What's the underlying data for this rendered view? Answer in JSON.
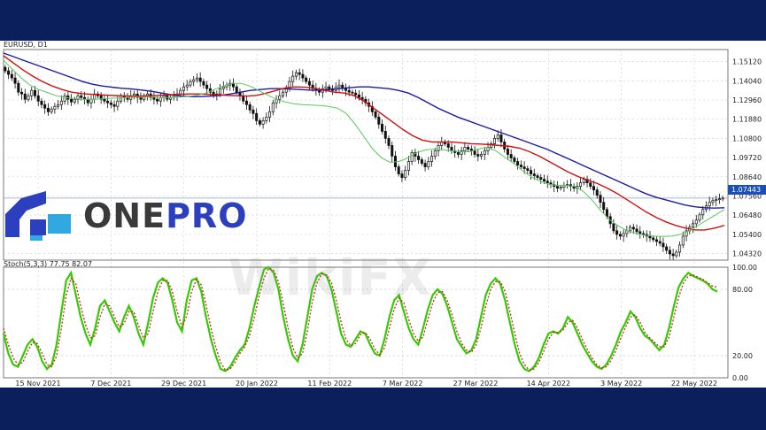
{
  "branding": {
    "logo_text_1": "ONE",
    "logo_text_2": "PRO",
    "watermark": "WikiFX",
    "colors": {
      "frame": "#0b1f5c",
      "logo_dark": "#3a3a3a",
      "logo_blue": "#2b3fbf",
      "logo_light": "#31a8e0"
    }
  },
  "chart_data": [
    {
      "type": "candlestick",
      "title": "EURUSD, D1",
      "current_price": 1.07443,
      "current_price_label": "1.07443",
      "ylim": [
        1.0395,
        1.158
      ],
      "y_ticks": [
        "1.15120",
        "1.14040",
        "1.12960",
        "1.11880",
        "1.10800",
        "1.09720",
        "1.08640",
        "1.07560",
        "1.06480",
        "1.05400",
        "1.04320"
      ],
      "x_ticks": [
        "15 Nov 2021",
        "7 Dec 2021",
        "29 Dec 2021",
        "20 Jan 2022",
        "11 Feb 2022",
        "7 Mar 2022",
        "27 Mar 2022",
        "14 Apr 2022",
        "3 May 2022",
        "22 May 2022"
      ],
      "close": [
        1.146,
        1.144,
        1.142,
        1.139,
        1.134,
        1.133,
        1.13,
        1.132,
        1.135,
        1.132,
        1.129,
        1.127,
        1.125,
        1.123,
        1.1245,
        1.126,
        1.127,
        1.129,
        1.132,
        1.13,
        1.1285,
        1.13,
        1.132,
        1.131,
        1.13,
        1.128,
        1.13,
        1.133,
        1.132,
        1.13,
        1.129,
        1.128,
        1.127,
        1.126,
        1.129,
        1.132,
        1.131,
        1.13,
        1.132,
        1.133,
        1.131,
        1.13,
        1.132,
        1.133,
        1.131,
        1.13,
        1.129,
        1.131,
        1.132,
        1.13,
        1.131,
        1.132,
        1.133,
        1.135,
        1.137,
        1.138,
        1.14,
        1.141,
        1.142,
        1.14,
        1.138,
        1.136,
        1.134,
        1.132,
        1.133,
        1.136,
        1.137,
        1.138,
        1.139,
        1.137,
        1.134,
        1.132,
        1.129,
        1.127,
        1.124,
        1.122,
        1.118,
        1.116,
        1.118,
        1.12,
        1.123,
        1.128,
        1.13,
        1.132,
        1.134,
        1.136,
        1.14,
        1.143,
        1.145,
        1.144,
        1.142,
        1.14,
        1.138,
        1.136,
        1.135,
        1.134,
        1.136,
        1.137,
        1.136,
        1.135,
        1.137,
        1.138,
        1.1365,
        1.135,
        1.134,
        1.1335,
        1.1325,
        1.131,
        1.13,
        1.128,
        1.126,
        1.123,
        1.12,
        1.116,
        1.112,
        1.108,
        1.104,
        1.098,
        1.092,
        1.088,
        1.086,
        1.09,
        1.095,
        1.1,
        1.098,
        1.096,
        1.094,
        1.092,
        1.095,
        1.098,
        1.101,
        1.104,
        1.106,
        1.105,
        1.103,
        1.101,
        1.1,
        1.099,
        1.101,
        1.103,
        1.102,
        1.101,
        1.099,
        1.098,
        1.099,
        1.101,
        1.103,
        1.105,
        1.108,
        1.11,
        1.106,
        1.102,
        1.099,
        1.097,
        1.095,
        1.093,
        1.092,
        1.091,
        1.09,
        1.088,
        1.087,
        1.086,
        1.085,
        1.084,
        1.083,
        1.082,
        1.081,
        1.08,
        1.0805,
        1.0815,
        1.082,
        1.081,
        1.08,
        1.081,
        1.083,
        1.085,
        1.083,
        1.081,
        1.079,
        1.076,
        1.072,
        1.068,
        1.064,
        1.06,
        1.056,
        1.054,
        1.053,
        1.0545,
        1.056,
        1.058,
        1.057,
        1.0555,
        1.0545,
        1.054,
        1.053,
        1.052,
        1.051,
        1.05,
        1.049,
        1.047,
        1.045,
        1.043,
        1.042,
        1.044,
        1.048,
        1.053,
        1.056,
        1.058,
        1.06,
        1.062,
        1.065,
        1.068,
        1.07,
        1.072,
        1.073,
        1.0735,
        1.074,
        1.0744
      ],
      "series": [
        {
          "color": "#1a1aa6",
          "values": [
            1.156,
            1.154,
            1.152,
            1.15,
            1.148,
            1.146,
            1.144,
            1.142,
            1.14,
            1.1385,
            1.1375,
            1.1368,
            1.1362,
            1.1358,
            1.1352,
            1.1345,
            1.1335,
            1.1325,
            1.1318,
            1.1315,
            1.1315,
            1.1318,
            1.1322,
            1.133,
            1.134,
            1.135,
            1.1355,
            1.136,
            1.136,
            1.1358,
            1.1355,
            1.1352,
            1.135,
            1.1355,
            1.136,
            1.1365,
            1.137,
            1.137,
            1.1365,
            1.136,
            1.135,
            1.1335,
            1.131,
            1.128,
            1.125,
            1.1225,
            1.12,
            1.118,
            1.116,
            1.114,
            1.112,
            1.11,
            1.108,
            1.106,
            1.104,
            1.102,
            1.0995,
            1.097,
            1.0945,
            1.092,
            1.0895,
            1.087,
            1.0845,
            1.082,
            1.0795,
            1.077,
            1.075,
            1.0735,
            1.072,
            1.0705,
            1.0695,
            1.069,
            1.0688,
            1.069
          ]
        },
        {
          "color": "#d01010",
          "values": [
            1.1545,
            1.1505,
            1.1465,
            1.143,
            1.14,
            1.1375,
            1.1355,
            1.134,
            1.1332,
            1.1328,
            1.1325,
            1.1322,
            1.132,
            1.1318,
            1.1318,
            1.132,
            1.1322,
            1.1325,
            1.1328,
            1.133,
            1.133,
            1.1328,
            1.1325,
            1.1322,
            1.132,
            1.1318,
            1.1322,
            1.1335,
            1.135,
            1.1365,
            1.137,
            1.1368,
            1.1362,
            1.135,
            1.134,
            1.1335,
            1.132,
            1.129,
            1.125,
            1.121,
            1.117,
            1.113,
            1.1095,
            1.107,
            1.106,
            1.106,
            1.106,
            1.1055,
            1.105,
            1.1048,
            1.1045,
            1.104,
            1.1035,
            1.1025,
            1.1005,
            1.098,
            1.095,
            1.092,
            1.089,
            1.0865,
            1.0845,
            1.0825,
            1.08,
            1.077,
            1.0735,
            1.07,
            1.0665,
            1.0635,
            1.061,
            1.059,
            1.0575,
            1.0565,
            1.0565,
            1.0575,
            1.059
          ]
        },
        {
          "color": "#59c959",
          "values": [
            1.152,
            1.147,
            1.142,
            1.138,
            1.1355,
            1.1338,
            1.132,
            1.131,
            1.1305,
            1.13,
            1.13,
            1.1302,
            1.1305,
            1.1308,
            1.131,
            1.1312,
            1.1313,
            1.1312,
            1.131,
            1.131,
            1.1312,
            1.1316,
            1.1322,
            1.1335,
            1.1355,
            1.1375,
            1.139,
            1.139,
            1.1375,
            1.135,
            1.1325,
            1.13,
            1.1285,
            1.1275,
            1.127,
            1.1268,
            1.1265,
            1.126,
            1.125,
            1.122,
            1.116,
            1.109,
            1.102,
            1.097,
            1.0945,
            1.095,
            1.097,
            1.1,
            1.1015,
            1.102,
            1.1015,
            1.101,
            1.1005,
            1.1005,
            1.102,
            1.103,
            1.101,
            1.0975,
            1.094,
            1.09,
            1.0865,
            1.084,
            1.0822,
            1.0815,
            1.0815,
            1.081,
            1.078,
            1.073,
            1.067,
            1.062,
            1.0585,
            1.056,
            1.0545,
            1.0535,
            1.053,
            1.0528,
            1.053,
            1.054,
            1.056,
            1.059,
            1.062,
            1.065,
            1.068
          ]
        }
      ]
    },
    {
      "type": "line",
      "title": "Stoch(5,3,3) 77.75 82.07",
      "ylim": [
        0,
        100
      ],
      "y_ticks": [
        "100.00",
        "80.00",
        "20.00",
        "0.00"
      ],
      "series": [
        {
          "color": "#33cc00",
          "values": [
            40,
            22,
            12,
            10,
            20,
            30,
            35,
            28,
            15,
            8,
            12,
            30,
            60,
            88,
            95,
            75,
            55,
            40,
            30,
            45,
            65,
            70,
            60,
            50,
            42,
            55,
            65,
            55,
            40,
            30,
            50,
            72,
            86,
            90,
            86,
            70,
            50,
            42,
            70,
            88,
            90,
            78,
            55,
            35,
            20,
            8,
            6,
            10,
            18,
            25,
            30,
            45,
            65,
            82,
            98,
            100,
            95,
            80,
            55,
            35,
            20,
            15,
            30,
            55,
            80,
            92,
            95,
            92,
            80,
            60,
            40,
            30,
            28,
            35,
            42,
            40,
            30,
            22,
            20,
            35,
            55,
            70,
            75,
            60,
            45,
            35,
            30,
            45,
            62,
            75,
            80,
            76,
            65,
            50,
            35,
            28,
            22,
            25,
            35,
            55,
            75,
            85,
            90,
            85,
            70,
            50,
            30,
            15,
            8,
            6,
            10,
            18,
            30,
            40,
            42,
            40,
            45,
            55,
            50,
            40,
            30,
            22,
            15,
            10,
            8,
            12,
            20,
            30,
            42,
            50,
            60,
            55,
            45,
            38,
            35,
            30,
            25,
            30,
            45,
            65,
            82,
            90,
            95,
            92,
            90,
            88,
            85,
            80,
            78
          ]
        },
        {
          "color": "#cc2222",
          "dashed": true,
          "values": [
            45,
            30,
            18,
            12,
            14,
            24,
            32,
            31,
            22,
            12,
            10,
            20,
            45,
            75,
            90,
            85,
            65,
            48,
            36,
            38,
            55,
            67,
            65,
            55,
            46,
            49,
            60,
            60,
            47,
            36,
            40,
            60,
            78,
            88,
            88,
            78,
            60,
            46,
            56,
            78,
            89,
            84,
            66,
            45,
            28,
            14,
            7,
            8,
            14,
            22,
            28,
            38,
            55,
            74,
            90,
            99,
            97,
            87,
            67,
            45,
            27,
            18,
            22,
            42,
            68,
            86,
            94,
            93,
            86,
            70,
            50,
            35,
            29,
            31,
            39,
            41,
            35,
            26,
            21,
            27,
            45,
            62,
            72,
            68,
            53,
            40,
            33,
            37,
            53,
            68,
            77,
            78,
            70,
            57,
            42,
            31,
            25,
            23,
            30,
            45,
            65,
            80,
            87,
            87,
            78,
            60,
            40,
            22,
            12,
            7,
            8,
            14,
            24,
            35,
            41,
            41,
            43,
            50,
            52,
            45,
            35,
            26,
            18,
            12,
            9,
            10,
            16,
            25,
            36,
            46,
            55,
            57,
            50,
            41,
            36,
            32,
            28,
            28,
            37,
            55,
            73,
            86,
            92,
            93,
            91,
            89,
            86,
            83,
            82
          ]
        }
      ]
    }
  ]
}
